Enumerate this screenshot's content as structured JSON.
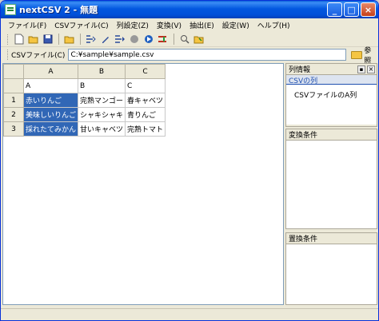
{
  "window": {
    "title": "nextCSV 2 - 無題"
  },
  "title_buttons": {
    "minimize": "_",
    "maximize": "□",
    "close": "×"
  },
  "menu": [
    "ファイル(F)",
    "CSVファイル(C)",
    "列設定(Z)",
    "変換(V)",
    "抽出(E)",
    "設定(W)",
    "ヘルプ(H)"
  ],
  "toolbar": {
    "icons": [
      "new-file-icon",
      "open-folder-icon",
      "save-icon",
      "folder-icon",
      "columns-icon",
      "pencil-icon",
      "transform-icon",
      "stop-icon",
      "run-icon",
      "split-icon",
      "search-icon",
      "export-icon"
    ]
  },
  "addr": {
    "label": "CSVファイル(C)",
    "value": "C:¥sample¥sample.csv",
    "browse": "参照"
  },
  "grid": {
    "col_headers": [
      "A",
      "B",
      "C"
    ],
    "header_row": [
      "A",
      "B",
      "C"
    ],
    "rows": [
      {
        "num": "1",
        "cells": [
          "赤いりんご",
          "完熟マンゴー",
          "春キャベツ"
        ]
      },
      {
        "num": "2",
        "cells": [
          "美味しいりんご",
          "シャキシャキ",
          "青りんご"
        ]
      },
      {
        "num": "3",
        "cells": [
          "採れたてみかん",
          "甘いキャベツ",
          "完熟トマト"
        ]
      }
    ]
  },
  "side": {
    "col_info": {
      "title": "列情報",
      "tab": "CSVの列",
      "item": "CSVファイルのA列"
    },
    "convert": {
      "title": "変換条件"
    },
    "replace": {
      "title": "置換条件"
    }
  }
}
